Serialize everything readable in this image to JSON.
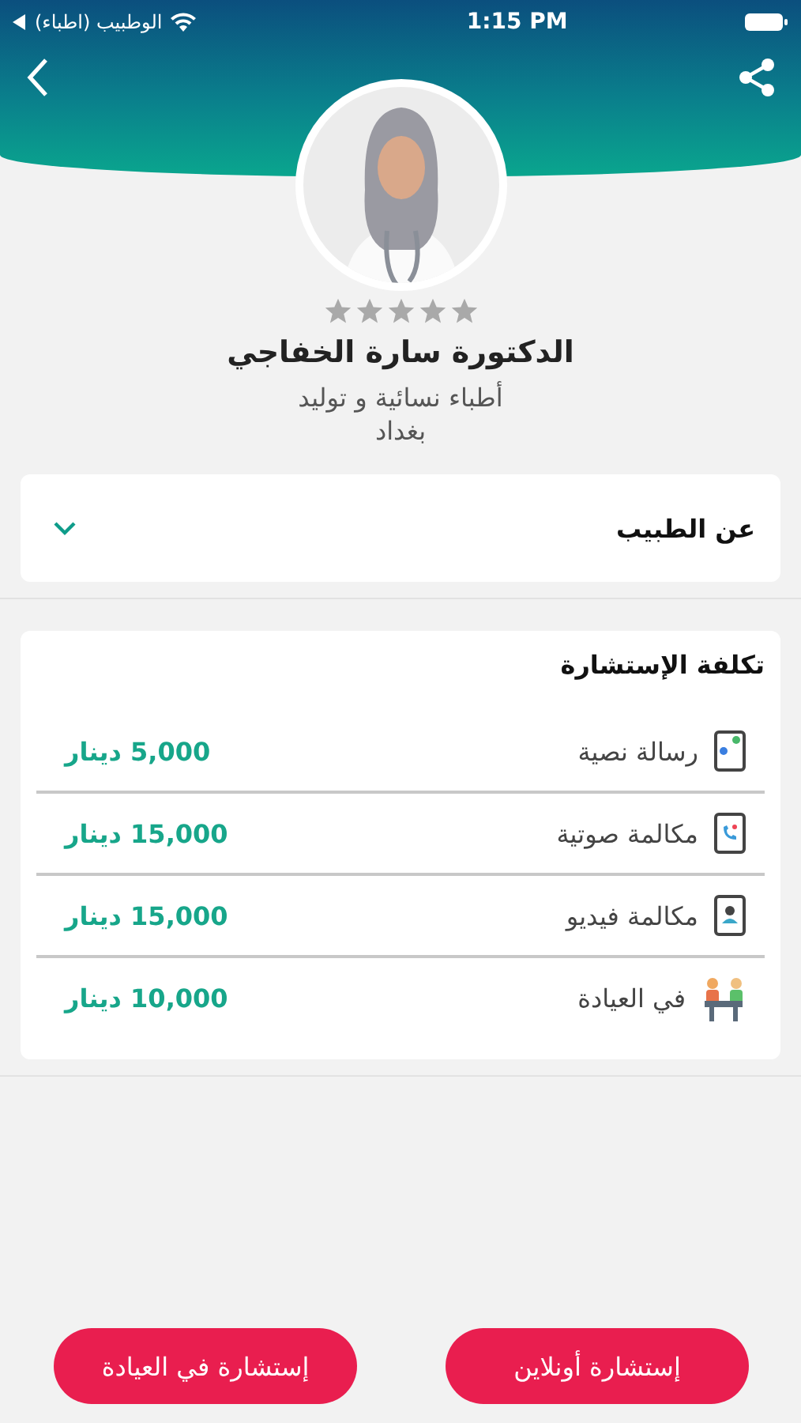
{
  "status_bar": {
    "carrier": "الوطبيب (اطباء)",
    "time": "1:15 PM"
  },
  "doctor": {
    "stars": 0,
    "name": "الدكتورة سارة الخفاجي",
    "specialty": "أطباء نسائية و توليد",
    "city": "بغداد"
  },
  "about": {
    "title": "عن الطبيب",
    "expanded": false
  },
  "cost": {
    "title": "تكلفة الإستشارة",
    "items": [
      {
        "kind": "text",
        "label": "رسالة نصية",
        "price": "5,000 دينار"
      },
      {
        "kind": "voice",
        "label": "مكالمة صوتية",
        "price": "15,000 دينار"
      },
      {
        "kind": "video",
        "label": "مكالمة فيديو",
        "price": "15,000 دينار"
      },
      {
        "kind": "clinic",
        "label": "في العيادة",
        "price": "10,000 دينار"
      }
    ]
  },
  "buttons": [
    "إستشارة أونلاين",
    "إستشارة في العيادة"
  ]
}
